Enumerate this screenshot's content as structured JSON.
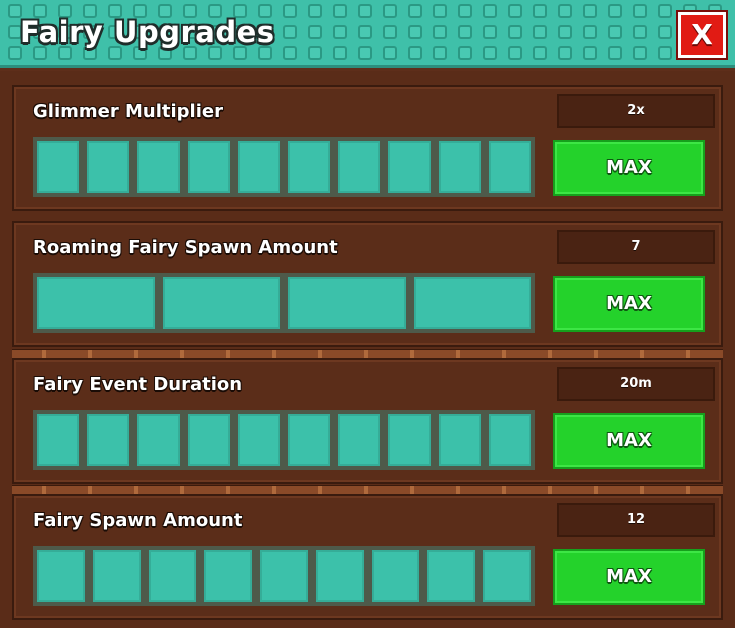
{
  "window": {
    "title": "Fairy Upgrades",
    "close_label": "X"
  },
  "upgrades": [
    {
      "name": "Glimmer Multiplier",
      "value": "2x",
      "segments_total": 10,
      "segments_filled": 10,
      "button_label": "MAX"
    },
    {
      "name": "Roaming Fairy Spawn Amount",
      "value": "7",
      "segments_total": 4,
      "segments_filled": 4,
      "button_label": "MAX"
    },
    {
      "name": "Fairy Event Duration",
      "value": "20m",
      "segments_total": 10,
      "segments_filled": 10,
      "button_label": "MAX"
    },
    {
      "name": "Fairy Spawn Amount",
      "value": "12",
      "segments_total": 9,
      "segments_filled": 9,
      "button_label": "MAX"
    }
  ],
  "colors": {
    "title_bar": "#3fc0a9",
    "panel_bg": "#5a2c18",
    "segment_fill": "#3cc1aa",
    "max_button": "#24d22b",
    "close_button": "#e11b14"
  }
}
